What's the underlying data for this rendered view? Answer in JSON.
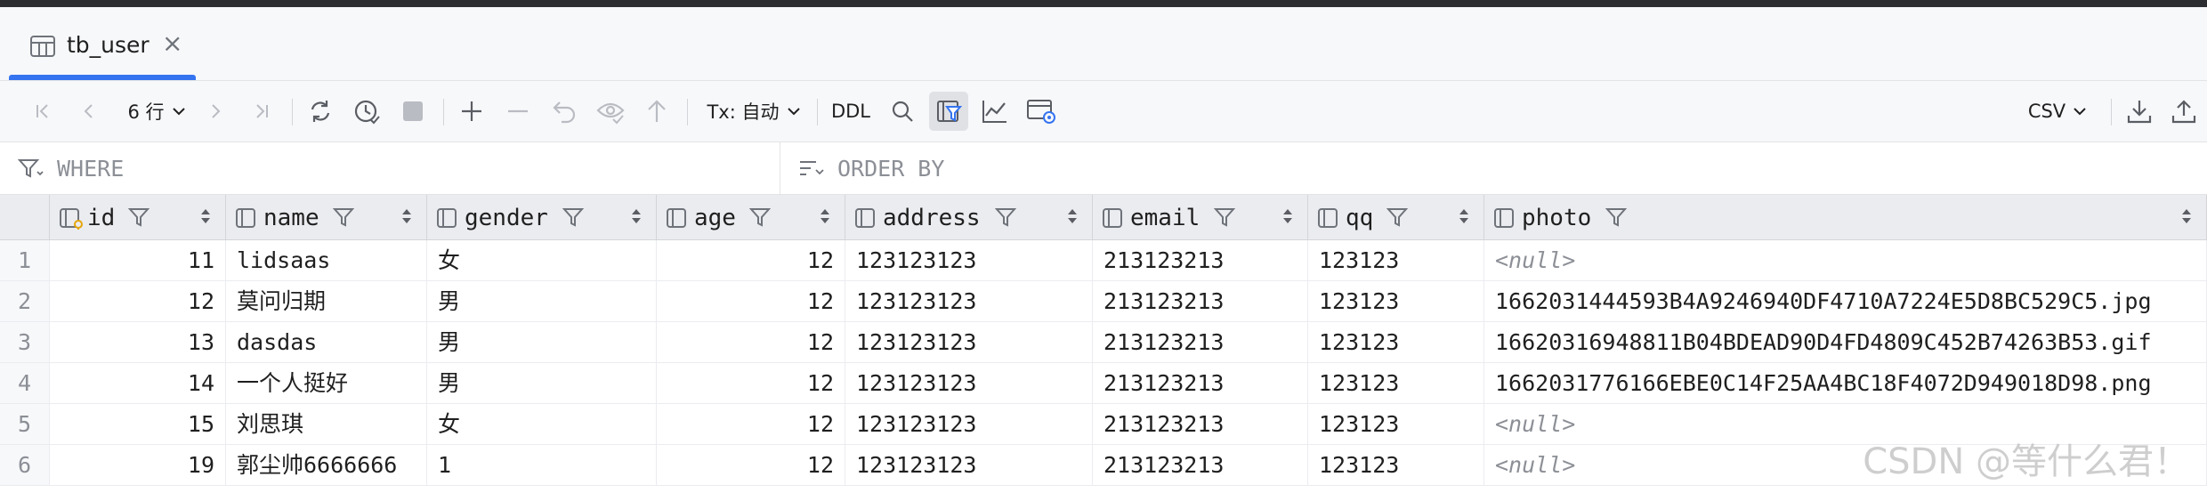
{
  "tab": {
    "label": "tb_user",
    "close": "×",
    "icon": "table-icon"
  },
  "toolbar": {
    "rows_label": "6 行",
    "tx_label": "Tx: 自动",
    "ddl_label": "DDL",
    "export_format": "CSV"
  },
  "filters": {
    "where_placeholder": "WHERE",
    "orderby_placeholder": "ORDER BY"
  },
  "table": {
    "columns": [
      {
        "name": "id",
        "icon": "primary-key-column-icon"
      },
      {
        "name": "name",
        "icon": "column-icon"
      },
      {
        "name": "gender",
        "icon": "column-icon"
      },
      {
        "name": "age",
        "icon": "column-icon"
      },
      {
        "name": "address",
        "icon": "column-icon"
      },
      {
        "name": "email",
        "icon": "column-icon"
      },
      {
        "name": "qq",
        "icon": "column-icon"
      },
      {
        "name": "photo",
        "icon": "column-icon"
      }
    ],
    "rows": [
      {
        "n": "1",
        "id": "11",
        "name": "lidsaas",
        "gender": "女",
        "age": "12",
        "address": "123123123",
        "email": "213123213",
        "qq": "123123",
        "photo": "<null>"
      },
      {
        "n": "2",
        "id": "12",
        "name": "莫问归期",
        "gender": "男",
        "age": "12",
        "address": "123123123",
        "email": "213123213",
        "qq": "123123",
        "photo": "1662031444593B4A9246940DF4710A7224E5D8BC529C5.jpg"
      },
      {
        "n": "3",
        "id": "13",
        "name": "dasdas",
        "gender": "男",
        "age": "12",
        "address": "123123123",
        "email": "213123213",
        "qq": "123123",
        "photo": "16620316948811B04BDEAD90D4FD4809C452B74263B53.gif"
      },
      {
        "n": "4",
        "id": "14",
        "name": "一个人挺好",
        "gender": "男",
        "age": "12",
        "address": "123123123",
        "email": "213123213",
        "qq": "123123",
        "photo": "1662031776166EBE0C14F25AA4BC18F4072D949018D98.png"
      },
      {
        "n": "5",
        "id": "15",
        "name": "刘思琪",
        "gender": "女",
        "age": "12",
        "address": "123123123",
        "email": "213123213",
        "qq": "123123",
        "photo": "<null>"
      },
      {
        "n": "6",
        "id": "19",
        "name": "郭尘帅6666666",
        "gender": "1",
        "age": "12",
        "address": "123123123",
        "email": "213123213",
        "qq": "123123",
        "photo": "<null>"
      }
    ]
  },
  "watermark": "CSDN @等什么君！"
}
